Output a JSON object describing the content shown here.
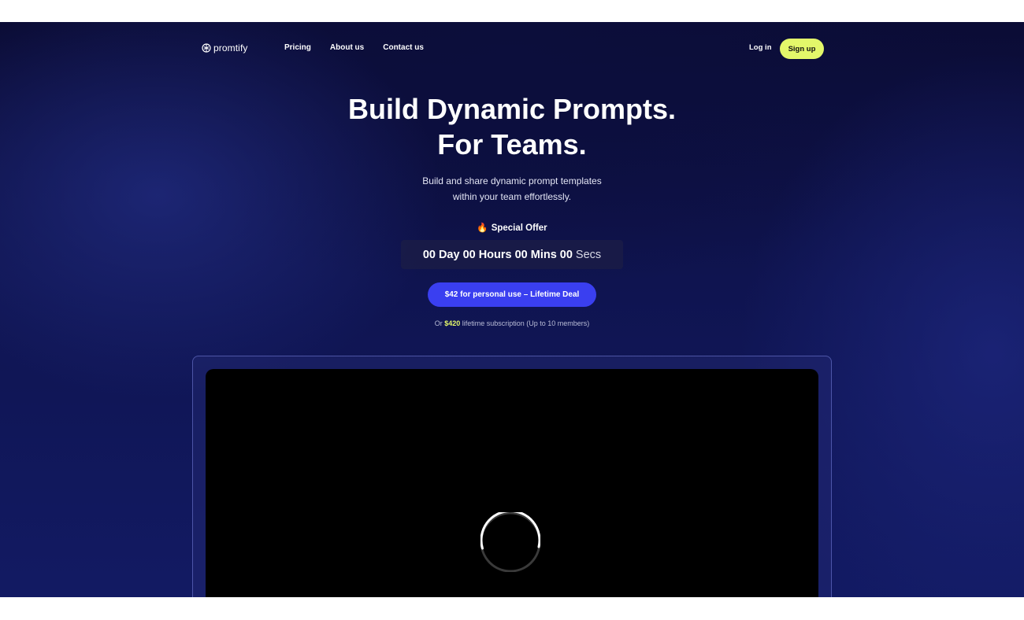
{
  "brand": {
    "name": "promtify",
    "icon": "logo-mark-icon"
  },
  "nav": {
    "links": [
      {
        "label": "Pricing"
      },
      {
        "label": "About us"
      },
      {
        "label": "Contact us"
      }
    ],
    "login_label": "Log in",
    "signup_label": "Sign up"
  },
  "hero": {
    "title_line1": "Build Dynamic Prompts.",
    "title_line2": "For Teams.",
    "subtitle_line1": "Build and share dynamic prompt templates",
    "subtitle_line2": "within your team effortlessly."
  },
  "offer": {
    "icon": "fire-icon",
    "label": "Special Offer",
    "countdown": {
      "days_value": "00",
      "days_unit": "Day",
      "hours_value": "00",
      "hours_unit": "Hours",
      "mins_value": "00",
      "mins_unit": "Mins",
      "secs_value": "00",
      "secs_unit": "Secs"
    },
    "deal_button_label": "$42 for personal use – Lifetime Deal",
    "lifetime_prefix": "Or",
    "lifetime_price": "$420",
    "lifetime_suffix": "lifetime subscription (Up to 10 members)"
  },
  "video": {
    "state_icon": "loading-spinner-icon"
  },
  "colors": {
    "accent_yellow": "#e3f76a",
    "cta_blue": "#3a3ff0",
    "background_navy": "#0f1450"
  }
}
